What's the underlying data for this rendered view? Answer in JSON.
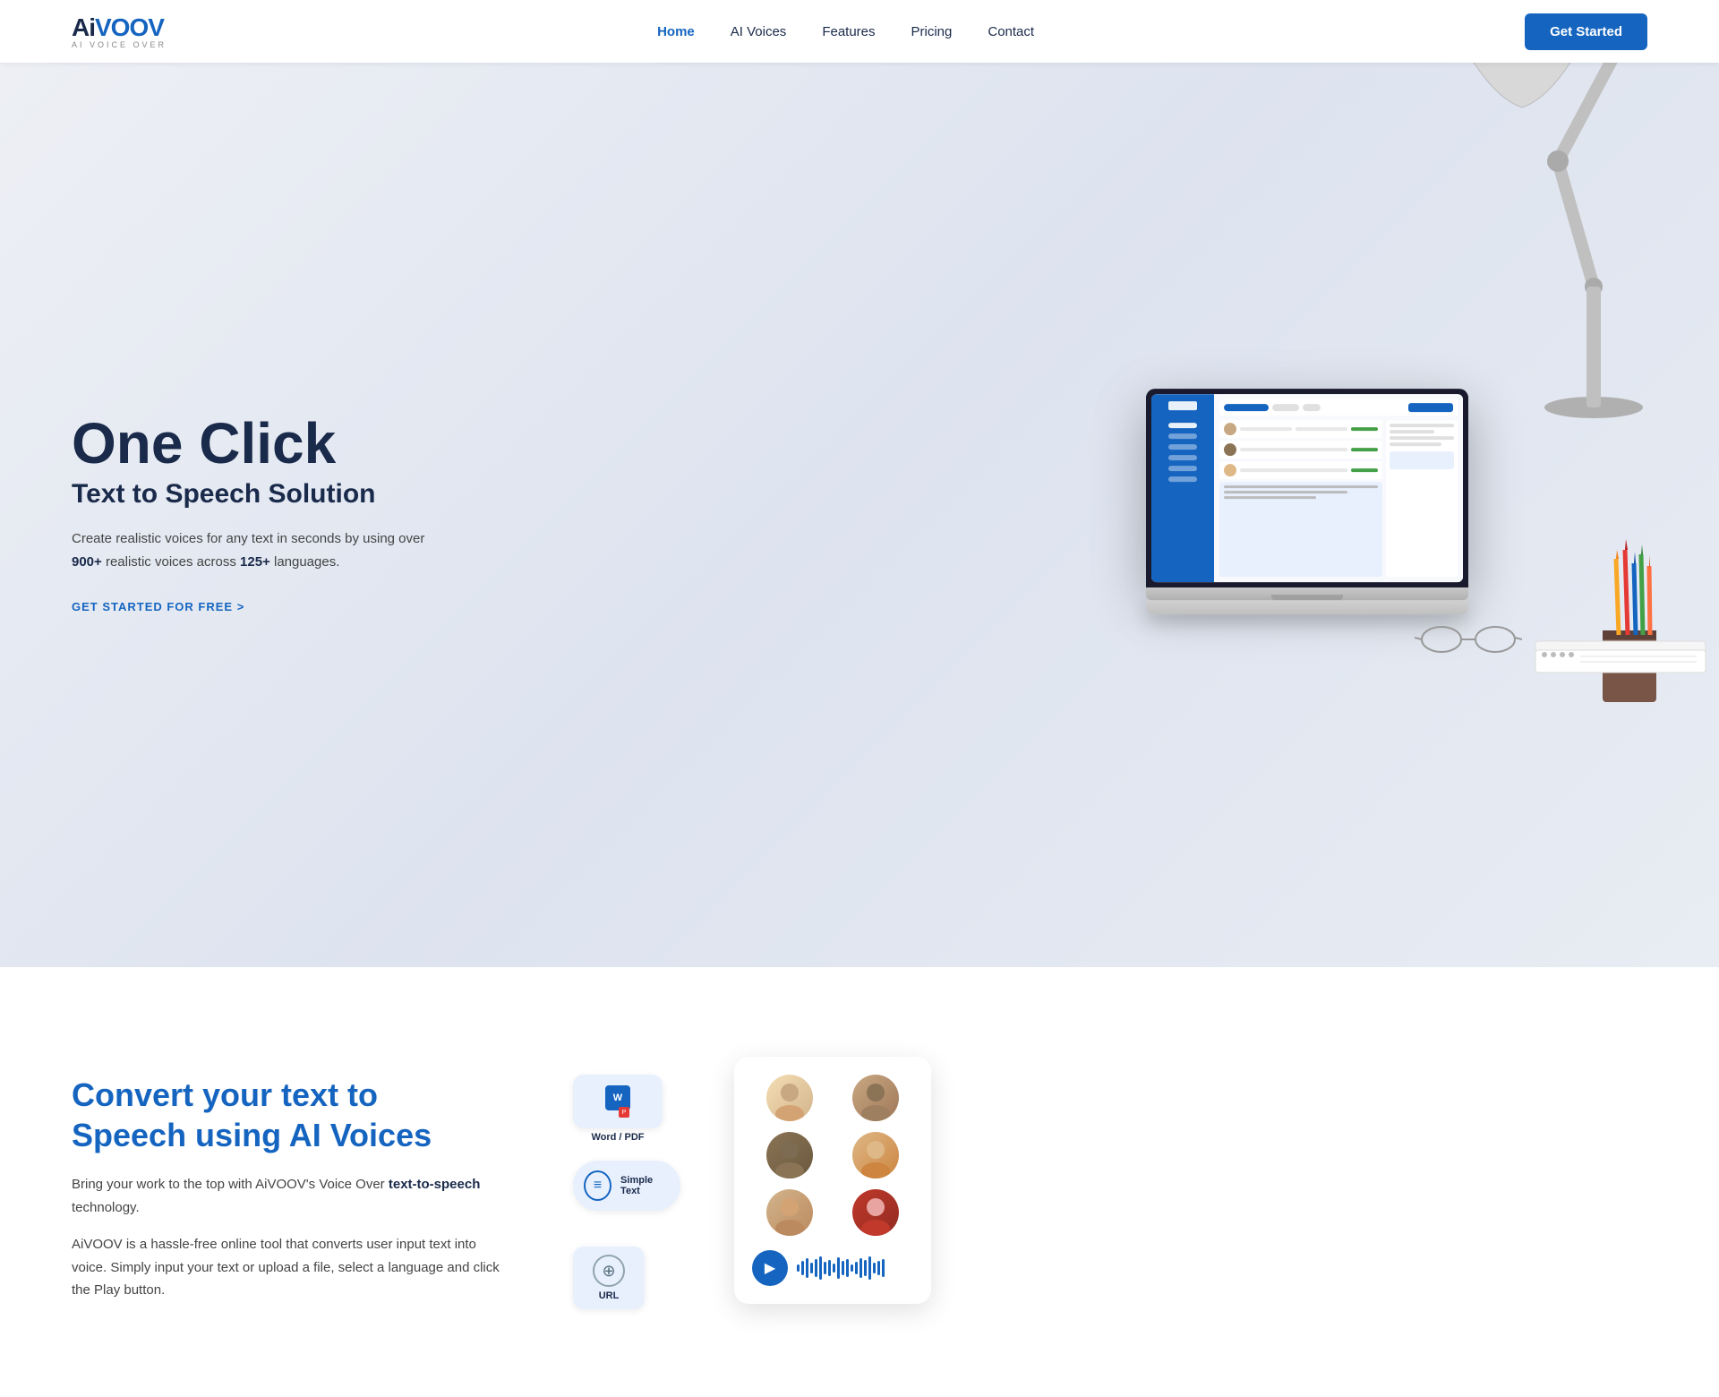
{
  "nav": {
    "logo": {
      "ai": "Ai",
      "voov": "VOOV",
      "sub": "AI VOICE OVER"
    },
    "links": [
      {
        "id": "home",
        "label": "Home",
        "active": true
      },
      {
        "id": "ai-voices",
        "label": "AI Voices",
        "active": false
      },
      {
        "id": "features",
        "label": "Features",
        "active": false
      },
      {
        "id": "pricing",
        "label": "Pricing",
        "active": false
      },
      {
        "id": "contact",
        "label": "Contact",
        "active": false
      }
    ],
    "cta_label": "Get Started"
  },
  "hero": {
    "title_main": "One Click",
    "title_sub": "Text to Speech Solution",
    "description_1": "Create realistic voices for any text in seconds by using over ",
    "highlight_1": "900+",
    "description_2": " realistic voices across ",
    "highlight_2": "125+",
    "description_3": " languages.",
    "cta_label": "GET STARTED FOR FREE >"
  },
  "section2": {
    "title_1": "Convert your text to",
    "title_2": "Speech using AI Voices",
    "desc_1": "Bring your work to the top with AiVOOV's Voice Over ",
    "highlight_1": "text-to-speech",
    "desc_1_end": " technology.",
    "desc_2": "AiVOOV is a hassle-free online tool that converts user input text into voice. Simply input your text or upload a file, select a language and click the Play button.",
    "input_methods": [
      {
        "id": "word-pdf",
        "label": "Word / PDF",
        "icon": "W"
      },
      {
        "id": "simple-text",
        "label": "Simple Text",
        "icon": "≡"
      },
      {
        "id": "url",
        "label": "URL",
        "icon": "⊕"
      }
    ],
    "voices_panel": {
      "play_label": "▶"
    }
  },
  "colors": {
    "primary": "#1565c0",
    "dark": "#1a2a4a",
    "light_bg": "#f4f5f7",
    "white": "#ffffff"
  }
}
